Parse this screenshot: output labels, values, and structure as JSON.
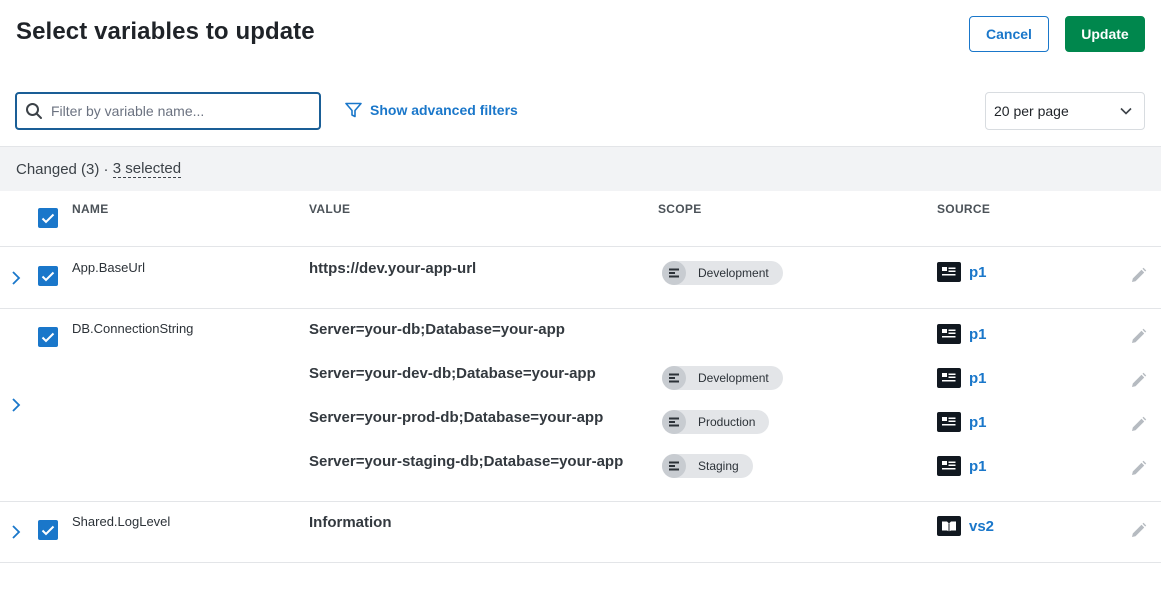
{
  "header": {
    "title": "Select variables to update",
    "cancel_label": "Cancel",
    "update_label": "Update"
  },
  "filters": {
    "search_placeholder": "Filter by variable name...",
    "advanced_label": "Show advanced filters",
    "per_page": "20 per page"
  },
  "group": {
    "label": "Changed (3) · ",
    "selected": "3 selected"
  },
  "columns": {
    "name": "NAME",
    "value": "VALUE",
    "scope": "SCOPE",
    "source": "SOURCE"
  },
  "rows": [
    {
      "name": "App.BaseUrl",
      "values": [
        {
          "value": "https://dev.your-app-url",
          "scope": "Development",
          "source": "p1"
        }
      ]
    },
    {
      "name": "DB.ConnectionString",
      "values": [
        {
          "value": "Server=your-db;Database=your-app",
          "scope": "",
          "source": "p1"
        },
        {
          "value": "Server=your-dev-db;Database=your-app",
          "scope": "Development",
          "source": "p1"
        },
        {
          "value": "Server=your-prod-db;Database=your-app",
          "scope": "Production",
          "source": "p1"
        },
        {
          "value": "Server=your-staging-db;Database=your-app",
          "scope": "Staging",
          "source": "p1"
        }
      ]
    },
    {
      "name": "Shared.LogLevel",
      "values": [
        {
          "value": "Information",
          "scope": "",
          "source": "vs2"
        }
      ]
    }
  ],
  "icons": {
    "search": "search-icon",
    "filter": "filter-icon",
    "dropdown": "chevron-down-icon",
    "expand": "chevron-right-icon",
    "check": "check-icon",
    "scope": "environment-icon",
    "project": "project-icon",
    "variable_set": "book-icon",
    "edit": "pencil-icon"
  },
  "colors": {
    "primary": "#1a77ca",
    "success": "#00874d",
    "text": "#1f2328"
  }
}
